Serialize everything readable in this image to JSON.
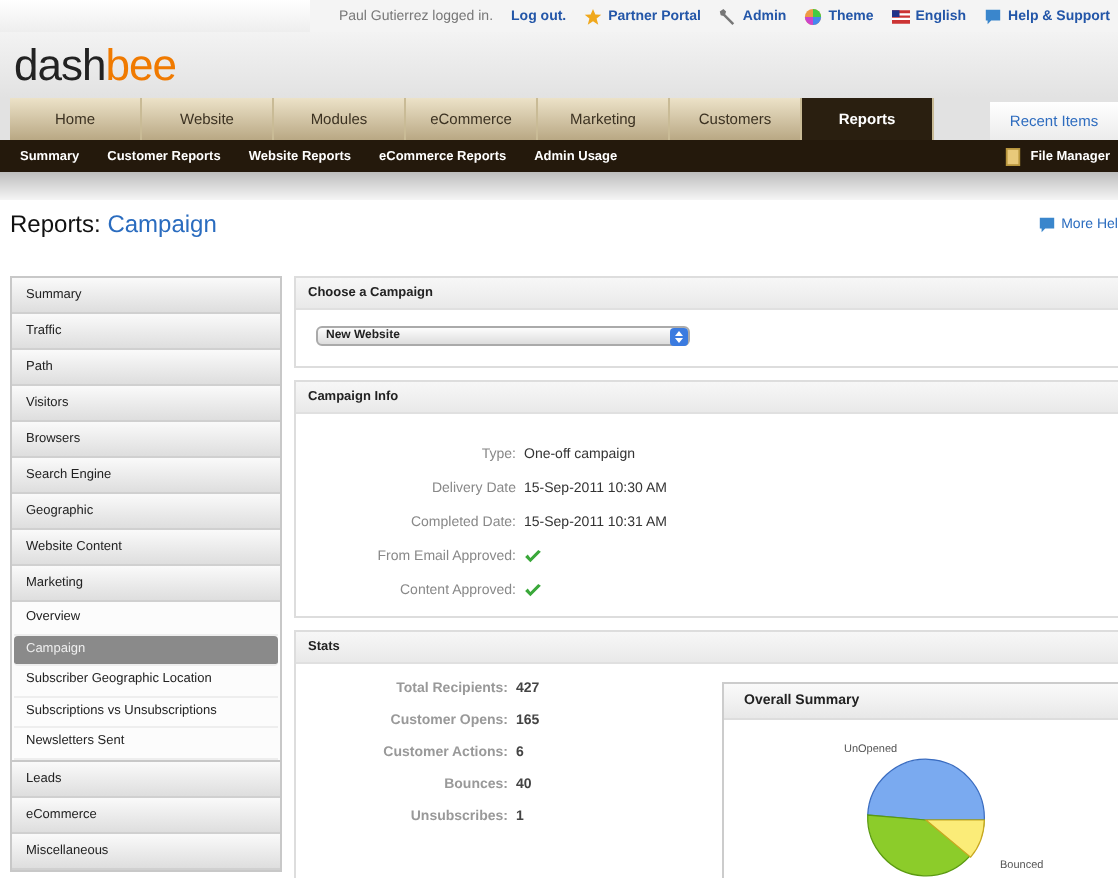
{
  "top_bar": {
    "user_text": "Paul Gutierrez logged in.",
    "links": [
      {
        "label": "Log out."
      },
      {
        "label": "Partner Portal"
      },
      {
        "label": "Admin"
      },
      {
        "label": "Theme"
      },
      {
        "label": "English"
      },
      {
        "label": "Help & Support"
      }
    ]
  },
  "logo": {
    "part_1": "dash",
    "part_2": "bee"
  },
  "tabs": [
    {
      "label": "Home",
      "selected": false
    },
    {
      "label": "Website",
      "selected": false
    },
    {
      "label": "Modules",
      "selected": false
    },
    {
      "label": "eCommerce",
      "selected": false
    },
    {
      "label": "Marketing",
      "selected": false
    },
    {
      "label": "Customers",
      "selected": false
    },
    {
      "label": "Reports",
      "selected": true
    }
  ],
  "recent_items": "Recent Items",
  "sub_nav": [
    "Summary",
    "Customer Reports",
    "Website Reports",
    "eCommerce Reports",
    "Admin Usage"
  ],
  "file_manager": "File Manager",
  "page_title": {
    "section": "Reports:",
    "page": "Campaign"
  },
  "more_help": "More Hel",
  "sidebar": {
    "items": [
      {
        "label": "Summary",
        "selected": false
      },
      {
        "label": "Traffic",
        "selected": false
      },
      {
        "label": "Path",
        "selected": false
      },
      {
        "label": "Visitors",
        "selected": false
      },
      {
        "label": "Browsers",
        "selected": false
      },
      {
        "label": "Search Engine",
        "selected": false
      },
      {
        "label": "Geographic",
        "selected": false
      },
      {
        "label": "Website Content",
        "selected": false
      },
      {
        "label": "Marketing",
        "selected": false,
        "expanded": true,
        "children": [
          {
            "label": "Overview",
            "selected": false
          },
          {
            "label": "Campaign",
            "selected": true
          },
          {
            "label": "Subscriber Geographic Location",
            "selected": false
          },
          {
            "label": "Subscriptions vs Unsubscriptions",
            "selected": false
          },
          {
            "label": "Newsletters Sent",
            "selected": false
          }
        ]
      },
      {
        "label": "Leads",
        "selected": false
      },
      {
        "label": "eCommerce",
        "selected": false
      },
      {
        "label": "Miscellaneous",
        "selected": false
      }
    ]
  },
  "choose_panel": {
    "title": "Choose a Campaign",
    "select_value": "New Website"
  },
  "info_panel": {
    "title": "Campaign Info",
    "rows": [
      {
        "kind": "text",
        "label": "Type:",
        "value": "One-off campaign"
      },
      {
        "kind": "text",
        "label": "Delivery Date",
        "value": "15-Sep-2011 10:30 AM"
      },
      {
        "kind": "text",
        "label": "Completed Date:",
        "value": "15-Sep-2011 10:31 AM"
      },
      {
        "kind": "check",
        "label": "From Email Approved:",
        "checked": true
      },
      {
        "kind": "check",
        "label": "Content Approved:",
        "checked": true
      }
    ]
  },
  "stats_panel": {
    "title": "Stats",
    "rows": [
      {
        "label": "Total Recipients:",
        "value": "427"
      },
      {
        "label": "Customer Opens:",
        "value": "165"
      },
      {
        "label": "Customer Actions:",
        "value": "6"
      },
      {
        "label": "Bounces:",
        "value": "40"
      },
      {
        "label": "Unsubscribes:",
        "value": "1"
      }
    ],
    "summary": {
      "title": "Overall Summary",
      "label_1": "UnOpened",
      "label_2": "Bounced"
    }
  }
}
